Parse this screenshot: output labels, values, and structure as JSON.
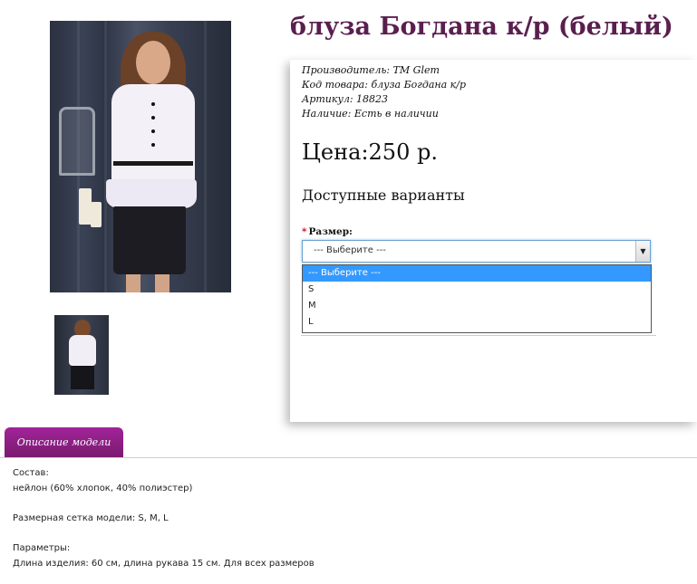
{
  "product": {
    "title": "блуза Богдана к/р (белый)",
    "manufacturer_label": "Производитель:",
    "manufacturer_value": "ТМ Glem",
    "code_label": "Код товара:",
    "code_value": "блуза Богдана к/р",
    "sku_label": "Артикул:",
    "sku_value": "18823",
    "stock_label": "Наличие:",
    "stock_value": "Есть в наличии",
    "price": "Цена:250 р.",
    "variants_title": "Доступные варианты",
    "size_required_mark": "*",
    "size_label": "Размер:",
    "size_select_value": "--- Выберите ---",
    "size_options": [
      "--- Выберите ---",
      "S",
      "M",
      "L"
    ]
  },
  "tabs": {
    "description_tab": "Описание модели"
  },
  "description": {
    "composition_title": "Состав:",
    "composition_value": "нейлон (60% хлопок, 40% полиэстер)",
    "size_grid": "Размерная сетка модели: S, M, L",
    "params_title": "Параметры:",
    "params_value": "Длина изделия: 60 см, длина рукава 15 см. Для всех размеров"
  },
  "colors": {
    "title": "#5a1f4e",
    "tab": "#8f1f86",
    "dropdown_highlight": "#3399ff",
    "required": "#cc0000"
  }
}
